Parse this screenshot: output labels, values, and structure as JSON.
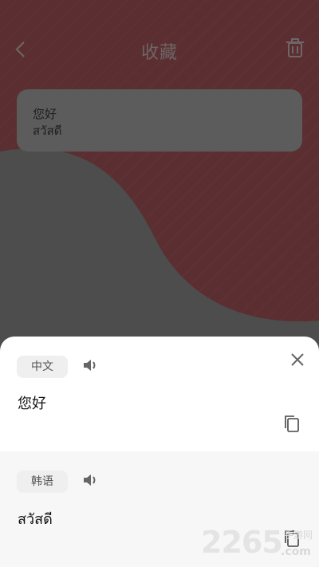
{
  "header": {
    "title": "收藏",
    "icons": {
      "back": "chevron-left-icon",
      "delete": "trash-icon"
    }
  },
  "favorite": {
    "source_text": "您好",
    "target_text": "สวัสดี"
  },
  "translation_sheet": {
    "source": {
      "language": "中文",
      "text": "您好"
    },
    "target": {
      "language": "韩语",
      "text": "สวัสดี"
    },
    "icons": {
      "close": "close-icon",
      "speaker": "speaker-icon",
      "copy": "copy-icon"
    }
  },
  "watermark": {
    "number": "2265",
    "suffix": ".com",
    "site_cn": "手游网"
  },
  "colors": {
    "backdrop": "#4d4d4d",
    "accent_background": "#5b2e31",
    "sheet": "#ffffff"
  }
}
